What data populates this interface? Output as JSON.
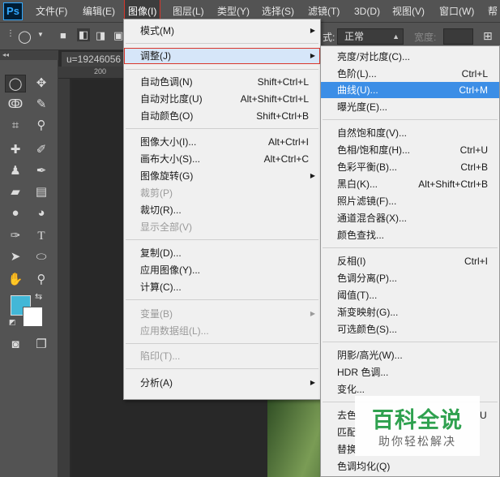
{
  "app": {
    "logo": "Ps"
  },
  "menubar": {
    "items": [
      {
        "label": "文件(F)"
      },
      {
        "label": "编辑(E)"
      },
      {
        "label": "图像(I)"
      },
      {
        "label": "图层(L)"
      },
      {
        "label": "类型(Y)"
      },
      {
        "label": "选择(S)"
      },
      {
        "label": "滤镜(T)"
      },
      {
        "label": "3D(D)"
      },
      {
        "label": "视图(V)"
      },
      {
        "label": "窗口(W)"
      },
      {
        "label": "帮"
      }
    ]
  },
  "options": {
    "mode_label": "式:",
    "mode_value": "正常",
    "width_label": "宽度:"
  },
  "document": {
    "tab_title": "u=19246056",
    "ruler_mark": "200"
  },
  "image_menu": {
    "items": [
      {
        "label": "模式(M)",
        "shortcut": ""
      },
      {
        "label": "调整(J)",
        "shortcut": ""
      },
      {
        "label": "自动色调(N)",
        "shortcut": "Shift+Ctrl+L"
      },
      {
        "label": "自动对比度(U)",
        "shortcut": "Alt+Shift+Ctrl+L"
      },
      {
        "label": "自动颜色(O)",
        "shortcut": "Shift+Ctrl+B"
      },
      {
        "label": "图像大小(I)...",
        "shortcut": "Alt+Ctrl+I"
      },
      {
        "label": "画布大小(S)...",
        "shortcut": "Alt+Ctrl+C"
      },
      {
        "label": "图像旋转(G)",
        "shortcut": ""
      },
      {
        "label": "裁剪(P)",
        "shortcut": ""
      },
      {
        "label": "裁切(R)...",
        "shortcut": ""
      },
      {
        "label": "显示全部(V)",
        "shortcut": ""
      },
      {
        "label": "复制(D)...",
        "shortcut": ""
      },
      {
        "label": "应用图像(Y)...",
        "shortcut": ""
      },
      {
        "label": "计算(C)...",
        "shortcut": ""
      },
      {
        "label": "变量(B)",
        "shortcut": ""
      },
      {
        "label": "应用数据组(L)...",
        "shortcut": ""
      },
      {
        "label": "陷印(T)...",
        "shortcut": ""
      },
      {
        "label": "分析(A)",
        "shortcut": ""
      }
    ]
  },
  "adjust_menu": {
    "items": [
      {
        "label": "亮度/对比度(C)...",
        "shortcut": ""
      },
      {
        "label": "色阶(L)...",
        "shortcut": "Ctrl+L"
      },
      {
        "label": "曲线(U)...",
        "shortcut": "Ctrl+M"
      },
      {
        "label": "曝光度(E)...",
        "shortcut": ""
      },
      {
        "label": "自然饱和度(V)...",
        "shortcut": ""
      },
      {
        "label": "色相/饱和度(H)...",
        "shortcut": "Ctrl+U"
      },
      {
        "label": "色彩平衡(B)...",
        "shortcut": "Ctrl+B"
      },
      {
        "label": "黑白(K)...",
        "shortcut": "Alt+Shift+Ctrl+B"
      },
      {
        "label": "照片滤镜(F)...",
        "shortcut": ""
      },
      {
        "label": "通道混合器(X)...",
        "shortcut": ""
      },
      {
        "label": "颜色查找...",
        "shortcut": ""
      },
      {
        "label": "反相(I)",
        "shortcut": "Ctrl+I"
      },
      {
        "label": "色调分离(P)...",
        "shortcut": ""
      },
      {
        "label": "阈值(T)...",
        "shortcut": ""
      },
      {
        "label": "渐变映射(G)...",
        "shortcut": ""
      },
      {
        "label": "可选颜色(S)...",
        "shortcut": ""
      },
      {
        "label": "阴影/高光(W)...",
        "shortcut": ""
      },
      {
        "label": "HDR 色调...",
        "shortcut": ""
      },
      {
        "label": "变化...",
        "shortcut": ""
      },
      {
        "label": "去色",
        "shortcut": ""
      },
      {
        "label": "匹配",
        "shortcut": ""
      },
      {
        "label": "替换",
        "shortcut": ""
      },
      {
        "label": "色调均化(Q)",
        "shortcut": ""
      }
    ],
    "partial_shortcut": "U"
  },
  "watermark": {
    "title": "百科全说",
    "subtitle": "助你轻松解决"
  },
  "colors": {
    "foreground": "#42b7d7",
    "background": "#ffffff",
    "highlight": "#3c8ee6",
    "hover_outline": "#d9362b"
  }
}
